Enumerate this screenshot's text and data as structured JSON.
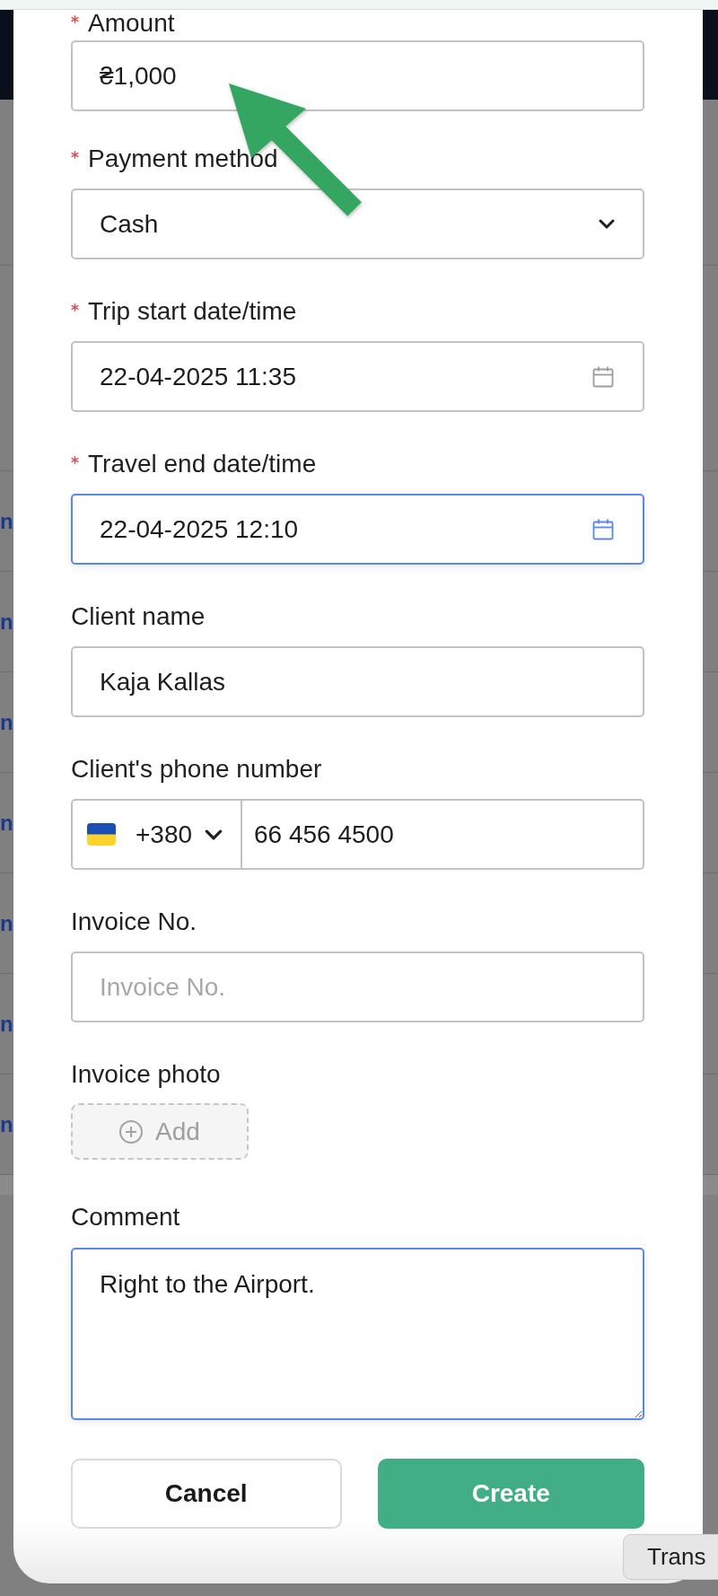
{
  "background_page": {
    "rows": [
      {
        "text": "n"
      },
      {
        "text": "n"
      },
      {
        "text": "n"
      },
      {
        "text": "n"
      },
      {
        "text": "n"
      },
      {
        "text": "n"
      },
      {
        "text": "n"
      }
    ]
  },
  "form": {
    "fields": [
      {
        "kind": "text",
        "label": "Amount",
        "required": true,
        "value": "₴1,000",
        "focused": false
      },
      {
        "kind": "select",
        "label": "Payment method",
        "required": true,
        "value": "Cash",
        "focused": false
      },
      {
        "kind": "datetime",
        "label": "Trip start date/time",
        "required": true,
        "value": "22-04-2025 11:35",
        "focused": false
      },
      {
        "kind": "datetime",
        "label": "Travel end date/time",
        "required": true,
        "value": "22-04-2025 12:10",
        "focused": true
      },
      {
        "kind": "text",
        "label": "Client name",
        "required": false,
        "value": "Kaja Kallas",
        "focused": false
      },
      {
        "kind": "phone",
        "label": "Client's phone number",
        "required": false,
        "country_code": "+380",
        "value": "66 456 4500",
        "focused": false
      },
      {
        "kind": "text",
        "label": "Invoice No.",
        "required": false,
        "placeholder": "Invoice No.",
        "focused": false
      },
      {
        "kind": "upload",
        "label": "Invoice photo",
        "required": false,
        "button": "Add",
        "focused": false
      },
      {
        "kind": "textarea",
        "label": "Comment",
        "required": false,
        "value": "Right to the Airport.",
        "focused": true
      }
    ]
  },
  "buttons": [
    {
      "kind": "secondary",
      "label": "Cancel"
    },
    {
      "kind": "primary",
      "label": "Create"
    }
  ],
  "tooltip": {
    "text": "Trans"
  }
}
